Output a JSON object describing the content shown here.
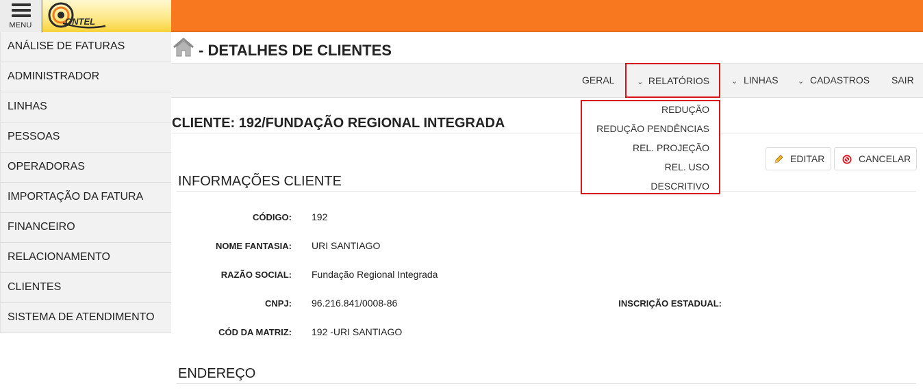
{
  "header": {
    "menu_label": "MENU",
    "brand_text": "ONTEL"
  },
  "sidebar": {
    "items": [
      {
        "label": "ANÁLISE DE FATURAS"
      },
      {
        "label": "ADMINISTRADOR"
      },
      {
        "label": "LINHAS"
      },
      {
        "label": "PESSOAS"
      },
      {
        "label": "OPERADORAS"
      },
      {
        "label": "IMPORTAÇÃO DA FATURA"
      },
      {
        "label": "FINANCEIRO"
      },
      {
        "label": "RELACIONAMENTO"
      },
      {
        "label": "CLIENTES"
      },
      {
        "label": "SISTEMA DE ATENDIMENTO"
      }
    ]
  },
  "page": {
    "title": "- DETALHES DE CLIENTES"
  },
  "nav": {
    "geral": "GERAL",
    "relatorios": "RELATÓRIOS",
    "linhas": "LINHAS",
    "cadastros": "CADASTROS",
    "sair": "SAIR"
  },
  "dropdown": {
    "items": [
      {
        "label": "REDUÇÃO"
      },
      {
        "label": "REDUÇÃO PENDÊNCIAS"
      },
      {
        "label": "REL. PROJEÇÃO"
      },
      {
        "label": "REL. USO"
      },
      {
        "label": "DESCRITIVO"
      }
    ]
  },
  "client": {
    "title": "CLIENTE: 192/FUNDAÇÃO REGIONAL INTEGRADA"
  },
  "actions": {
    "edit_label": "EDITAR",
    "cancel_label": "CANCELAR"
  },
  "info": {
    "section_title": "INFORMAÇÕES CLIENTE",
    "codigo_label": "CÓDIGO:",
    "codigo_value": "192",
    "nome_fantasia_label": "NOME FANTASIA:",
    "nome_fantasia_value": "URI SANTIAGO",
    "razao_social_label": "RAZÃO SOCIAL:",
    "razao_social_value": "Fundação Regional Integrada",
    "cnpj_label": "CNPJ:",
    "cnpj_value": "96.216.841/0008-86",
    "inscricao_estadual_label": "INSCRIÇÃO ESTADUAL:",
    "cod_matriz_label": "CÓD DA MATRIZ:",
    "cod_matriz_value": "192 -URI SANTIAGO"
  },
  "address": {
    "section_title": "ENDEREÇO"
  },
  "colors": {
    "topbar": "#f7781f",
    "highlight": "#d7141a",
    "sidebar_bg": "#f2f2f2"
  }
}
